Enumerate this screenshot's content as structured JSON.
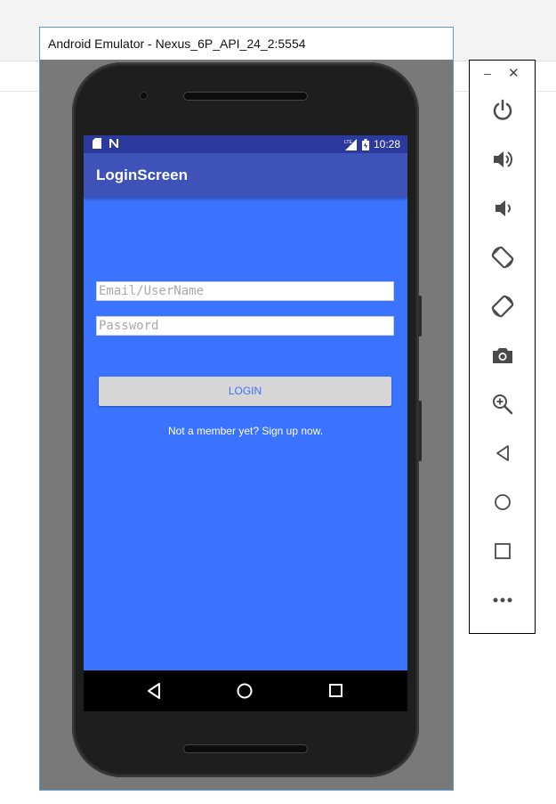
{
  "window": {
    "title": "Android Emulator - Nexus_6P_API_24_2:5554"
  },
  "status_bar": {
    "time": "10:28",
    "left_icons": [
      "sd-card-icon",
      "n-notification-icon"
    ],
    "right_icons": [
      "lte-signal-icon",
      "battery-icon"
    ]
  },
  "app": {
    "title": "LoginScreen",
    "email_placeholder": "Email/UserName",
    "password_placeholder": "Password",
    "login_label": "LOGIN",
    "signup_text": "Not a member yet? Sign up now."
  },
  "nav_bar": {
    "buttons": [
      "back-icon",
      "home-icon",
      "recents-icon"
    ]
  },
  "controls": {
    "buttons": [
      "power-icon",
      "volume-up-icon",
      "volume-down-icon",
      "rotate-left-icon",
      "rotate-right-icon",
      "camera-icon",
      "zoom-icon",
      "back-icon",
      "home-icon",
      "overview-icon",
      "more-icon"
    ],
    "window_buttons": [
      "minimize-icon",
      "close-icon"
    ]
  },
  "colors": {
    "screen_bg": "#3a73ff",
    "app_bar": "#3e52b8",
    "status_bar": "#2c3a9e",
    "button_bg": "#d6d6d6",
    "accent": "#3a73ff"
  }
}
